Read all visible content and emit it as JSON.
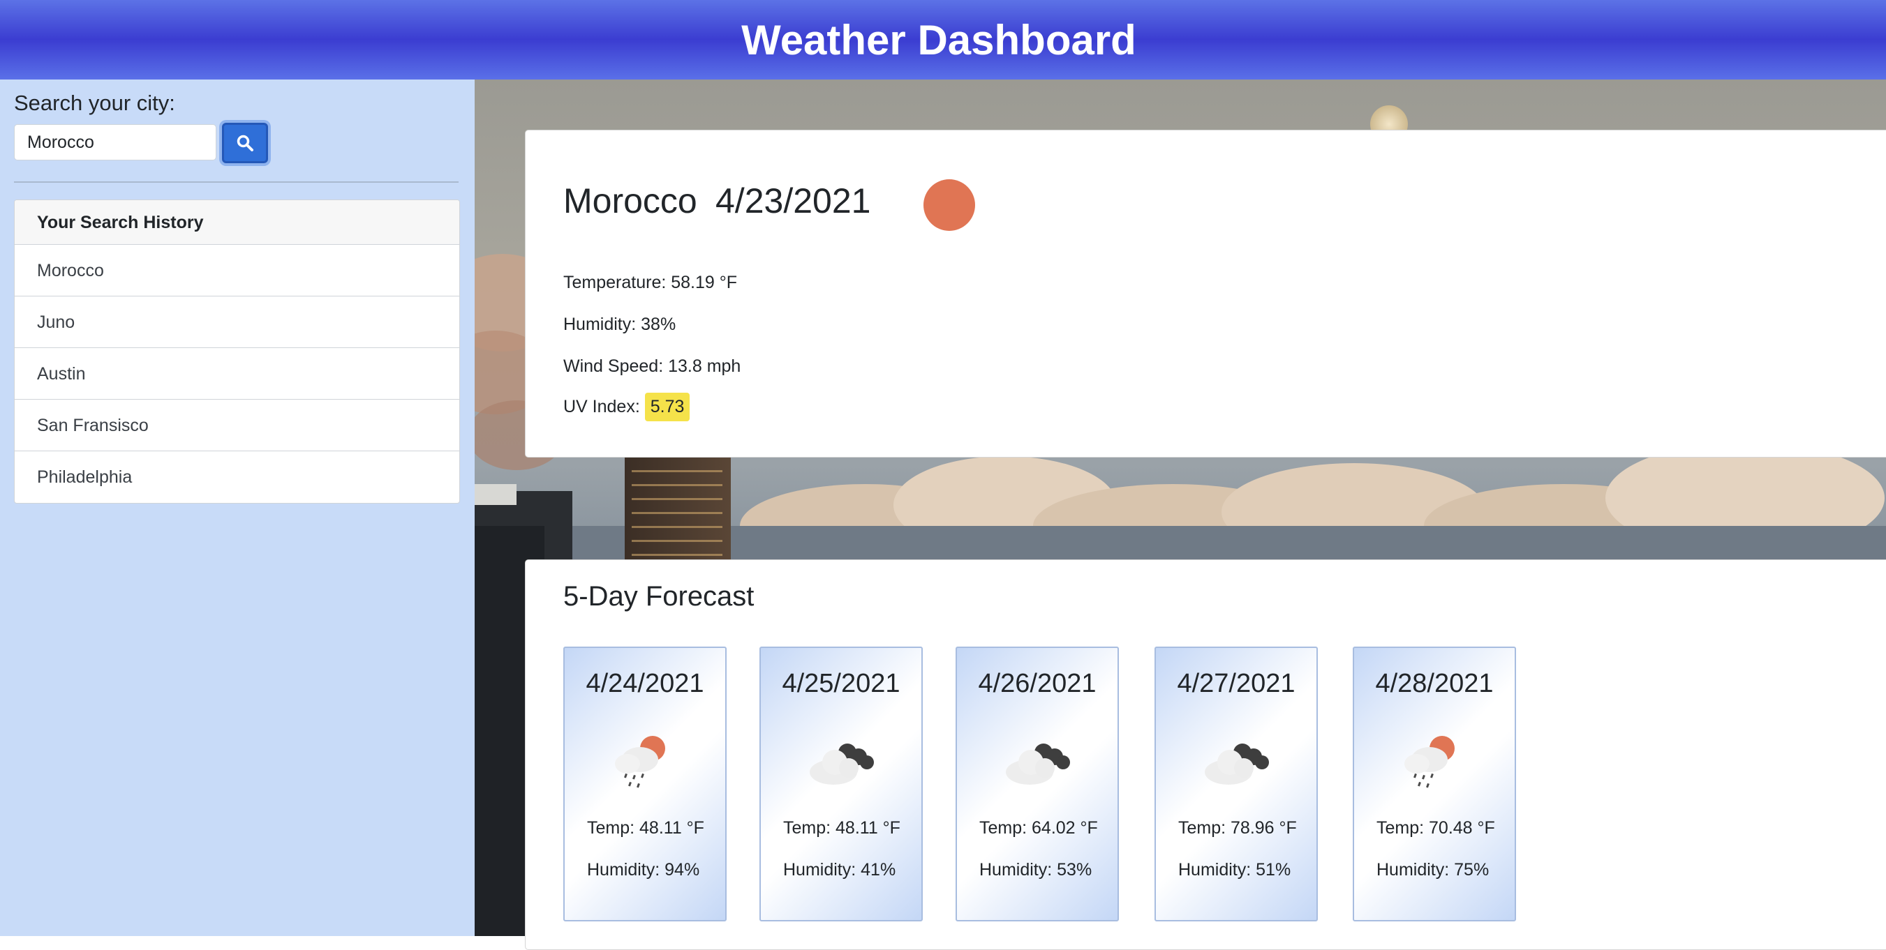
{
  "header": {
    "title": "Weather Dashboard"
  },
  "search": {
    "label": "Search your city:",
    "value": "Morocco",
    "button_icon": "search-icon"
  },
  "history": {
    "title": "Your Search History",
    "items": [
      "Morocco",
      "Juno",
      "Austin",
      "San Fransisco",
      "Philadelphia"
    ]
  },
  "current": {
    "city": "Morocco",
    "date": "4/23/2021",
    "icon": "sun-icon",
    "temperature": "Temperature: 58.19 °F",
    "humidity": "Humidity: 38%",
    "wind": "Wind Speed: 13.8 mph",
    "uv_label": "UV Index:",
    "uv_value": "5.73",
    "uv_color": "#f5e24a"
  },
  "forecast": {
    "title": "5-Day Forecast",
    "days": [
      {
        "date": "4/24/2021",
        "icon": "sun-rain-icon",
        "temp": "Temp: 48.11 °F",
        "humidity": "Humidity: 94%"
      },
      {
        "date": "4/25/2021",
        "icon": "clouds-icon",
        "temp": "Temp: 48.11 °F",
        "humidity": "Humidity: 41%"
      },
      {
        "date": "4/26/2021",
        "icon": "clouds-icon",
        "temp": "Temp: 64.02 °F",
        "humidity": "Humidity: 53%"
      },
      {
        "date": "4/27/2021",
        "icon": "clouds-icon",
        "temp": "Temp: 78.96 °F",
        "humidity": "Humidity: 51%"
      },
      {
        "date": "4/28/2021",
        "icon": "sun-rain-icon",
        "temp": "Temp: 70.48 °F",
        "humidity": "Humidity: 75%"
      }
    ]
  },
  "colors": {
    "header": "#3b3dd1",
    "sidebar": "#c8dbf8",
    "search_button": "#2f6fd8",
    "sun": "#e07554"
  }
}
